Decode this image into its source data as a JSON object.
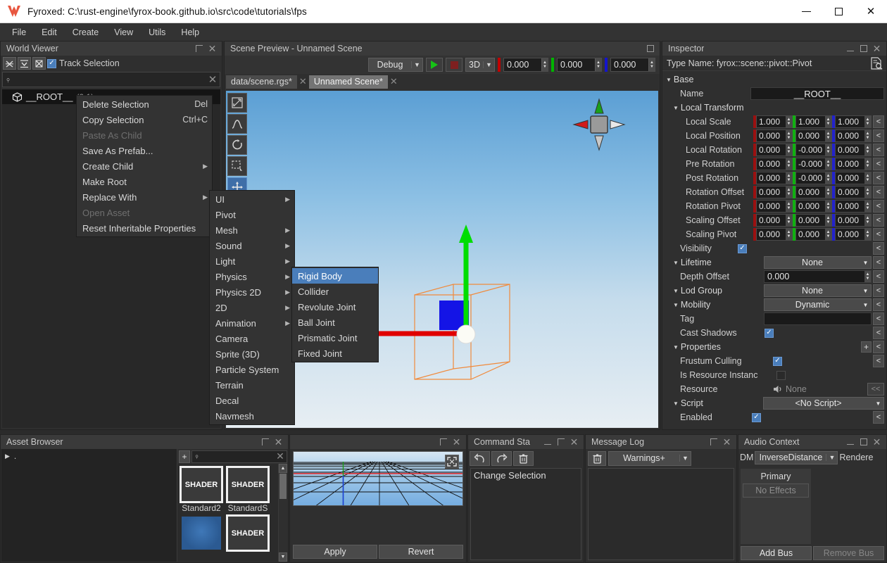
{
  "titlebar": {
    "title": "Fyroxed: C:\\rust-engine\\fyrox-book.github.io\\src\\code\\tutorials\\fps",
    "logo_icon": "fyrox-logo-icon",
    "minimize_icon": "window-minimize-icon",
    "maximize_icon": "window-maximize-icon",
    "close_icon": "window-close-icon"
  },
  "menubar": {
    "items": [
      {
        "label": "File"
      },
      {
        "label": "Edit"
      },
      {
        "label": "Create"
      },
      {
        "label": "View"
      },
      {
        "label": "Utils"
      },
      {
        "label": "Help"
      }
    ]
  },
  "world_viewer": {
    "title": "World Viewer",
    "toolbar": {
      "collapse_all_icon": "collapse-all-icon",
      "expand_all_icon": "expand-all-icon",
      "locate_selection_icon": "locate-selection-icon",
      "track_selection_label": "Track Selection",
      "track_selection_checked": true
    },
    "search": {
      "placeholder": "",
      "value": "",
      "icon": "search-icon",
      "clear_icon": "clear-icon"
    },
    "tree": [
      {
        "icon": "cube-icon",
        "label": "__ROOT__",
        "id": "(0:1)",
        "selected": true
      }
    ]
  },
  "scene_preview": {
    "title": "Scene Preview - Unnamed Scene",
    "maximize_icon": "maximize-icon",
    "toolbar": {
      "render_mode": "Debug",
      "play_icon": "play-icon",
      "stop_icon": "stop-icon",
      "dimension_mode": "3D",
      "coord_x": "0.000",
      "coord_y": "0.000",
      "coord_z": "0.000",
      "axis_colors": {
        "x": "#c00000",
        "y": "#00b400",
        "z": "#1414cc"
      }
    },
    "tabs": [
      {
        "label": "data/scene.rgs*",
        "active": false
      },
      {
        "label": "Unnamed Scene*",
        "active": true
      }
    ],
    "viewport_tools": [
      {
        "icon": "move-tool-icon",
        "selected": false
      },
      {
        "icon": "scale-tool-icon",
        "selected": false
      },
      {
        "icon": "rotate-tool-icon",
        "selected": false
      },
      {
        "icon": "select-rect-tool-icon",
        "selected": false
      },
      {
        "icon": "navigate-tool-icon",
        "selected": true
      }
    ],
    "gizmo": {
      "icon": "orientation-gizmo-icon"
    }
  },
  "inspector": {
    "title": "Inspector",
    "minimize_icon": "minimize-icon",
    "maximize_icon": "maximize-icon",
    "close_icon": "close-icon",
    "type_name": "Type Name: fyrox::scene::pivot::Pivot",
    "doc_icon": "document-search-icon",
    "revert_label": "<",
    "revert_wide_label": "<<",
    "add_label": "+",
    "groups": {
      "base": "Base",
      "local_transform": "Local Transform",
      "lifetime": "Lifetime",
      "lod_group": "Lod Group",
      "mobility": "Mobility",
      "properties": "Properties",
      "script": "Script"
    },
    "name_label": "Name",
    "name_value": "__ROOT__",
    "vectors": [
      {
        "label": "Local Scale",
        "x": "1.000",
        "y": "1.000",
        "z": "1.000"
      },
      {
        "label": "Local Position",
        "x": "0.000",
        "y": "0.000",
        "z": "0.000"
      },
      {
        "label": "Local Rotation",
        "x": "0.000",
        "y": "-0.000",
        "z": "0.000"
      },
      {
        "label": "Pre Rotation",
        "x": "0.000",
        "y": "-0.000",
        "z": "0.000"
      },
      {
        "label": "Post Rotation",
        "x": "0.000",
        "y": "-0.000",
        "z": "0.000"
      },
      {
        "label": "Rotation Offset",
        "x": "0.000",
        "y": "0.000",
        "z": "0.000"
      },
      {
        "label": "Rotation Pivot",
        "x": "0.000",
        "y": "0.000",
        "z": "0.000"
      },
      {
        "label": "Scaling Offset",
        "x": "0.000",
        "y": "0.000",
        "z": "0.000"
      },
      {
        "label": "Scaling Pivot",
        "x": "0.000",
        "y": "0.000",
        "z": "0.000"
      }
    ],
    "visibility_label": "Visibility",
    "visibility_checked": true,
    "lifetime_value": "None",
    "depth_offset_label": "Depth Offset",
    "depth_offset_value": "0.000",
    "lod_group_value": "None",
    "mobility_value": "Dynamic",
    "tag_label": "Tag",
    "tag_value": "",
    "cast_shadows_label": "Cast Shadows",
    "cast_shadows_checked": true,
    "frustum_culling_label": "Frustum Culling",
    "frustum_culling_checked": true,
    "is_resource_instance_label": "Is Resource Instanc",
    "is_resource_instance_checked": false,
    "resource_label": "Resource",
    "resource_value": "None",
    "resource_icon": "sound-icon",
    "script_value": "<No Script>",
    "enabled_label": "Enabled",
    "enabled_checked": true
  },
  "asset_browser": {
    "title": "Asset Browser",
    "maximize_icon": "maximize-icon",
    "close_icon": "close-icon",
    "tree_root": ".",
    "tree_expand_icon": "expand-arrow-icon",
    "add_label": "+",
    "search": {
      "value": "",
      "icon": "search-icon",
      "clear_icon": "clear-icon"
    },
    "items": [
      {
        "kind": "SHADER",
        "caption": "Standard2"
      },
      {
        "kind": "SHADER",
        "caption": "StandardS"
      },
      {
        "kind": "TEXTURE",
        "caption": ""
      },
      {
        "kind": "SHADER",
        "caption": ""
      }
    ],
    "scroll_up_icon": "scroll-up-icon",
    "scroll_down_icon": "scroll-down-icon"
  },
  "preview_panel": {
    "maximize_icon": "maximize-icon",
    "close_icon": "close-icon",
    "fit_icon": "fit-to-view-icon",
    "apply_label": "Apply",
    "revert_label": "Revert"
  },
  "command_stack": {
    "title": "Command Sta",
    "minimize_icon": "minimize-icon",
    "maximize_icon": "maximize-icon",
    "close_icon": "close-icon",
    "undo_icon": "undo-icon",
    "redo_icon": "redo-icon",
    "clear_icon": "trash-icon",
    "items": [
      {
        "label": "Change Selection"
      }
    ]
  },
  "message_log": {
    "title": "Message Log",
    "maximize_icon": "maximize-icon",
    "close_icon": "close-icon",
    "clear_icon": "trash-icon",
    "filter": "Warnings+",
    "items": []
  },
  "audio_context": {
    "title": "Audio Context",
    "minimize_icon": "minimize-icon",
    "maximize_icon": "maximize-icon",
    "close_icon": "close-icon",
    "dm_label": "DM",
    "distance_model": "InverseDistance",
    "renderer_label": "Rendere",
    "bus_name": "Primary",
    "no_effects_label": "No Effects",
    "add_bus_label": "Add Bus",
    "remove_bus_label": "Remove Bus"
  },
  "context_menu": {
    "items": [
      {
        "label": "Delete Selection",
        "shortcut": "Del",
        "disabled": false,
        "submenu": false
      },
      {
        "label": "Copy Selection",
        "shortcut": "Ctrl+C",
        "disabled": false,
        "submenu": false
      },
      {
        "label": "Paste As Child",
        "shortcut": "",
        "disabled": true,
        "submenu": false
      },
      {
        "label": "Save As Prefab...",
        "shortcut": "",
        "disabled": false,
        "submenu": false
      },
      {
        "label": "Create Child",
        "shortcut": "",
        "disabled": false,
        "submenu": true
      },
      {
        "label": "Make Root",
        "shortcut": "",
        "disabled": false,
        "submenu": false
      },
      {
        "label": "Replace With",
        "shortcut": "",
        "disabled": false,
        "submenu": true
      },
      {
        "label": "Open Asset",
        "shortcut": "",
        "disabled": true,
        "submenu": false
      },
      {
        "label": "Reset Inheritable Properties",
        "shortcut": "",
        "disabled": false,
        "submenu": false
      }
    ]
  },
  "create_child_menu": {
    "items": [
      {
        "label": "UI",
        "submenu": true
      },
      {
        "label": "Pivot",
        "submenu": false
      },
      {
        "label": "Mesh",
        "submenu": true
      },
      {
        "label": "Sound",
        "submenu": true
      },
      {
        "label": "Light",
        "submenu": true
      },
      {
        "label": "Physics",
        "submenu": true
      },
      {
        "label": "Physics 2D",
        "submenu": true
      },
      {
        "label": "2D",
        "submenu": true
      },
      {
        "label": "Animation",
        "submenu": true
      },
      {
        "label": "Camera",
        "submenu": false
      },
      {
        "label": "Sprite (3D)",
        "submenu": false
      },
      {
        "label": "Particle System",
        "submenu": false
      },
      {
        "label": "Terrain",
        "submenu": false
      },
      {
        "label": "Decal",
        "submenu": false
      },
      {
        "label": "Navmesh",
        "submenu": false
      }
    ]
  },
  "physics_menu": {
    "items": [
      {
        "label": "Rigid Body",
        "selected": true
      },
      {
        "label": "Collider",
        "selected": false
      },
      {
        "label": "Revolute Joint",
        "selected": false
      },
      {
        "label": "Ball Joint",
        "selected": false
      },
      {
        "label": "Prismatic Joint",
        "selected": false
      },
      {
        "label": "Fixed Joint",
        "selected": false
      }
    ]
  }
}
